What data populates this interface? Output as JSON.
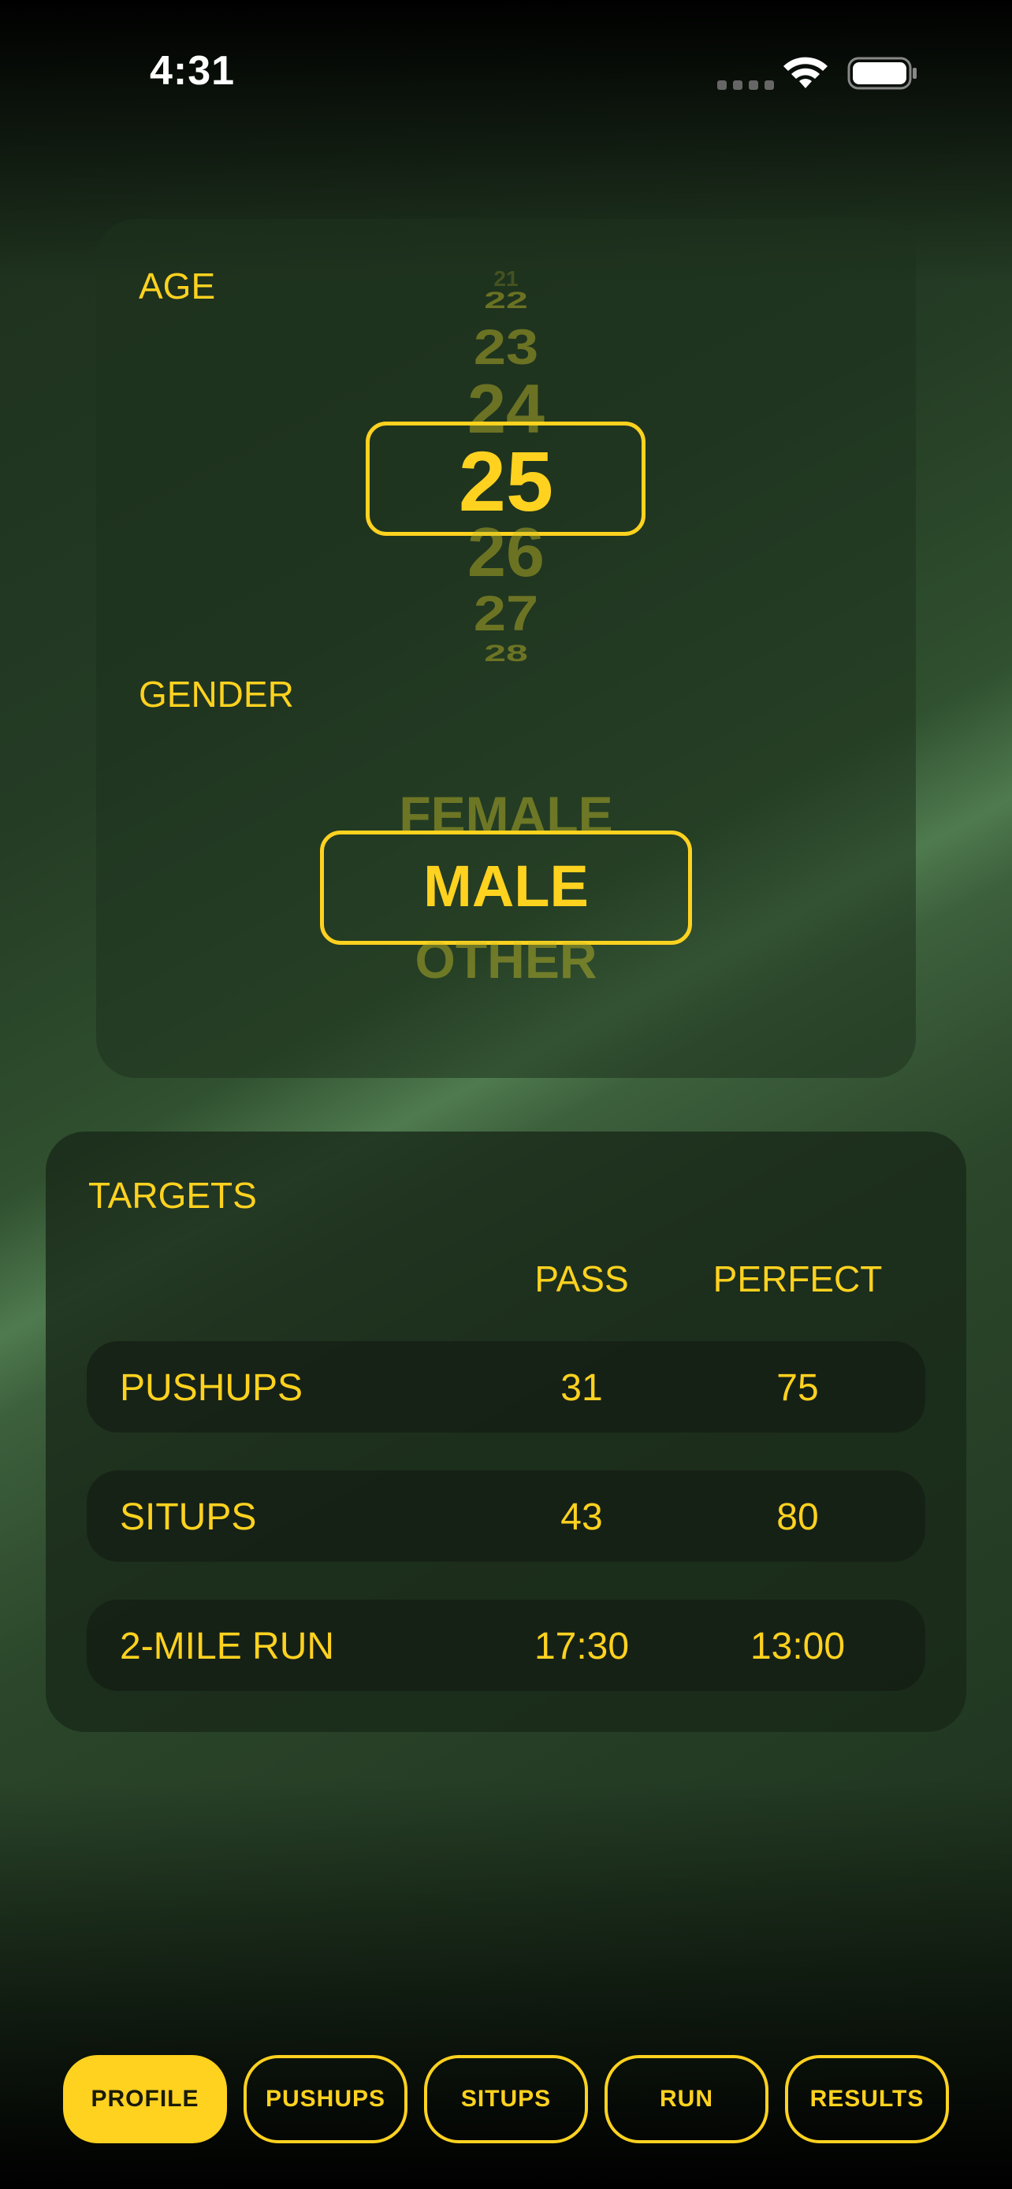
{
  "status_bar": {
    "time": "4:31",
    "wifi_icon": "wifi-icon",
    "battery_icon": "battery-icon"
  },
  "profile": {
    "age_label": "AGE",
    "age_picker": {
      "above": [
        "21",
        "22",
        "23",
        "24"
      ],
      "selected": "25",
      "below": [
        "26",
        "27",
        "28"
      ]
    },
    "gender_label": "GENDER",
    "gender_picker": {
      "above": "FEMALE",
      "selected": "MALE",
      "below": "OTHER"
    }
  },
  "targets": {
    "title": "TARGETS",
    "columns": [
      "PASS",
      "PERFECT"
    ],
    "rows": [
      {
        "name": "PUSHUPS",
        "pass": "31",
        "perfect": "75"
      },
      {
        "name": "SITUPS",
        "pass": "43",
        "perfect": "80"
      },
      {
        "name": "2-MILE RUN",
        "pass": "17:30",
        "perfect": "13:00"
      }
    ]
  },
  "tabs": [
    {
      "label": "PROFILE",
      "active": true
    },
    {
      "label": "PUSHUPS",
      "active": false
    },
    {
      "label": "SITUPS",
      "active": false
    },
    {
      "label": "RUN",
      "active": false
    },
    {
      "label": "RESULTS",
      "active": false
    }
  ],
  "colors": {
    "accent": "#FFD21F",
    "faded_accent": "#8C8A2A",
    "background": "#223822"
  }
}
